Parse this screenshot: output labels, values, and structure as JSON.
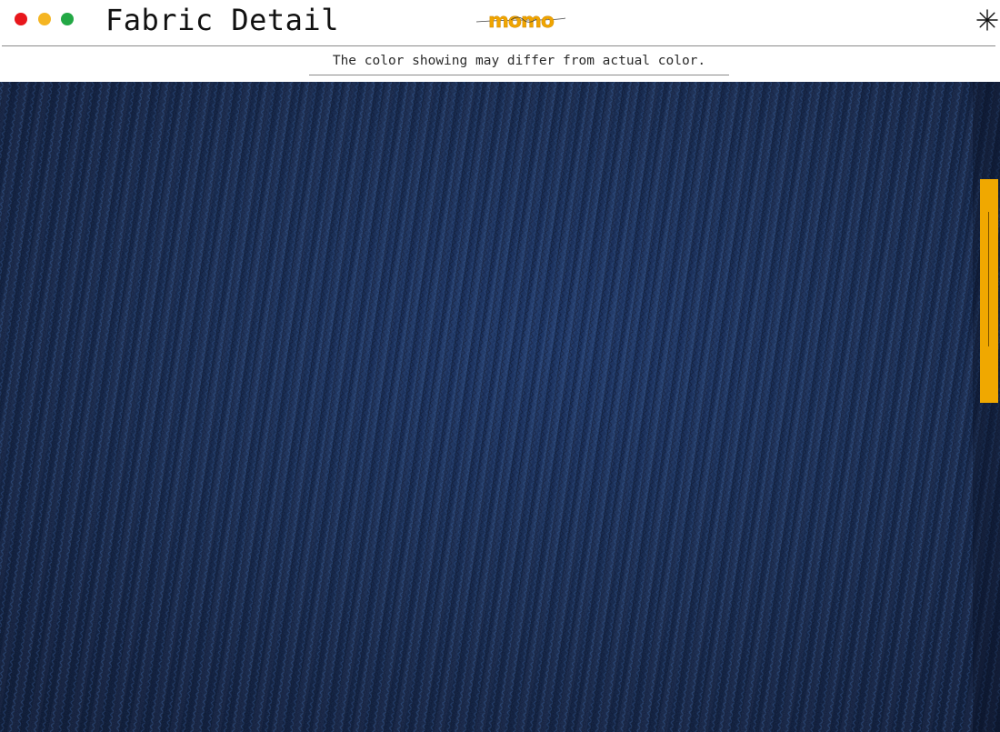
{
  "window": {
    "title": "Fabric Detail",
    "controls": {
      "close_color": "#e8171c",
      "minimize_color": "#f5b522",
      "maximize_color": "#23a845"
    }
  },
  "brand": {
    "logo_text": "momo",
    "logo_color": "#f0a500"
  },
  "menu": {
    "icon": "asterisk-icon"
  },
  "notice": {
    "text": "The color showing may differ from actual color."
  },
  "fabric": {
    "description_icon": "knit-fabric-texture",
    "base_color": "#13254a",
    "highlight_color": "#2a4f86",
    "shadow_color": "#0a1530"
  },
  "side_tab": {
    "color": "#f0a800",
    "icon": "drawer-handle-icon"
  },
  "colors": {
    "rule": "#8a8a8a",
    "title": "#111111"
  }
}
